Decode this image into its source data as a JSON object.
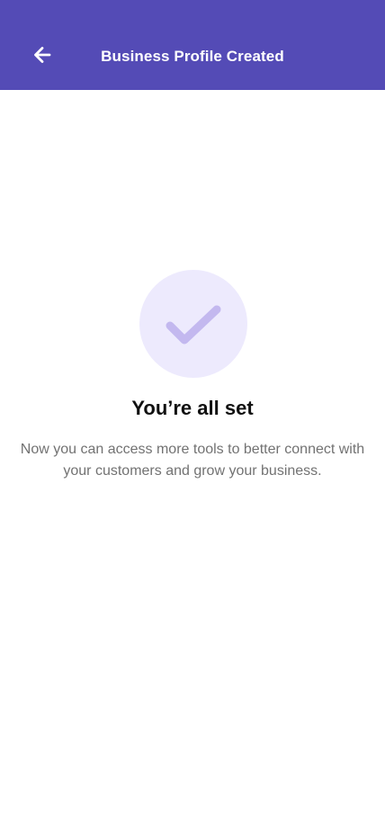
{
  "header": {
    "title": "Business Profile Created",
    "back_icon": "arrow-left-icon"
  },
  "status": {
    "icon": "checkmark-icon",
    "heading": "You’re all set",
    "message": "Now you can access more tools to better connect with your customers and grow your business."
  },
  "colors": {
    "header_bg": "#544bb6",
    "circle_bg": "#edeafd",
    "check": "#c3b8ef",
    "heading_text": "#111111",
    "body_text": "#727272"
  }
}
